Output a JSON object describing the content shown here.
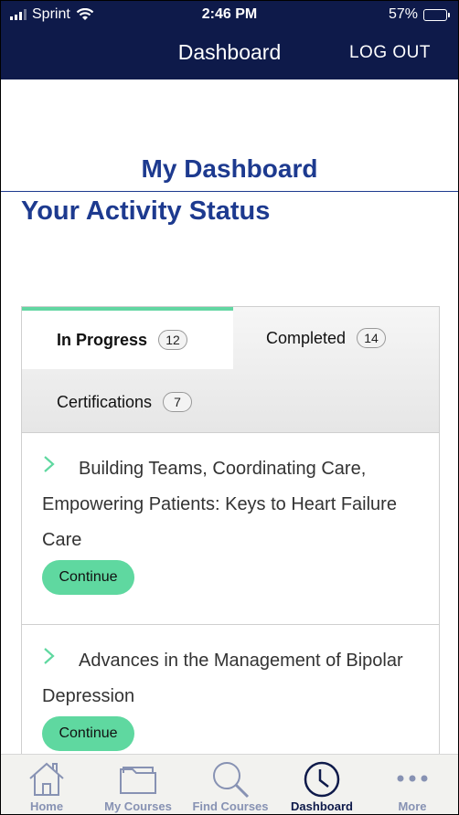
{
  "status_bar": {
    "carrier": "Sprint",
    "time": "2:46 PM",
    "battery": "57%",
    "battery_level": 0.57
  },
  "nav": {
    "title": "Dashboard",
    "logout": "LOG OUT"
  },
  "headings": {
    "dashboard": "My Dashboard",
    "activity": "Your Activity Status"
  },
  "tabs": [
    {
      "label": "In Progress",
      "count": "12",
      "active": true
    },
    {
      "label": "Completed",
      "count": "14",
      "active": false
    },
    {
      "label": "Certifications",
      "count": "7",
      "active": false
    }
  ],
  "courses": [
    {
      "title": "Building Teams, Coordinating Care, Empowering Patients: Keys to Heart Failure Care",
      "action": "Continue"
    },
    {
      "title": "Advances in the Management of Bipolar Depression",
      "action": "Continue"
    }
  ],
  "bottom_tabs": [
    {
      "label": "Home",
      "icon": "home-icon"
    },
    {
      "label": "My Courses",
      "icon": "folder-icon"
    },
    {
      "label": "Find Courses",
      "icon": "search-icon"
    },
    {
      "label": "Dashboard",
      "icon": "clock-icon",
      "active": true
    },
    {
      "label": "More",
      "icon": "more-icon"
    }
  ],
  "colors": {
    "navy": "#0e1a4a",
    "heading_blue": "#1d3a8f",
    "accent_green": "#5fd8a0"
  }
}
